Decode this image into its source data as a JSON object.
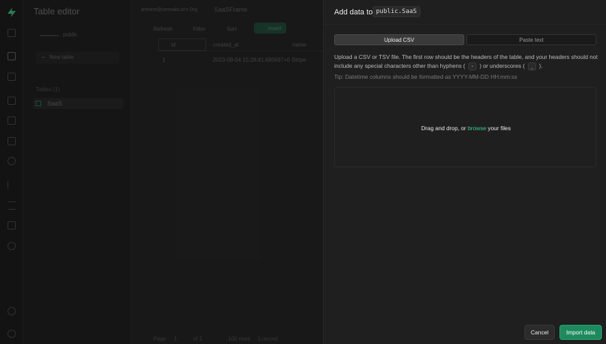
{
  "rail": {
    "icons": [
      "home-icon",
      "table-editor-icon",
      "sql-editor-icon",
      "database-icon",
      "auth-icon",
      "storage-icon",
      "edge-functions-icon",
      "realtime-icon",
      "reports-icon",
      "logs-icon",
      "api-docs-icon",
      "integrations-icon",
      "settings-icon",
      "user-icon"
    ]
  },
  "sidebar": {
    "title": "Table editor",
    "schema_value": "public",
    "new_table_label": "New table",
    "tables_heading": "Tables (1)",
    "tables": [
      {
        "label": "SaaS"
      }
    ]
  },
  "main": {
    "org": "antoine@ummaks.io's Org",
    "project": "SaaSFrame",
    "toolbar": {
      "refresh": "Refresh",
      "filter": "Filter",
      "sort": "Sort",
      "insert": "Insert"
    },
    "columns": [
      "id",
      "created_at",
      "name"
    ],
    "rows": [
      [
        "1",
        "2023-08-04 15:28:41.680697+0",
        "Stripe"
      ]
    ],
    "footer": {
      "page_label": "Page",
      "page_value": "1",
      "of": "of 1",
      "rows": "100 rows",
      "records": "1 record"
    }
  },
  "panel": {
    "title": "Add data to",
    "table_ref": "public.SaaS",
    "tabs": {
      "upload": "Upload CSV",
      "paste": "Paste text"
    },
    "desc_part1": "Upload a CSV or TSV file. The first row should be the headers of the table, and your headers should not include any special characters other than hyphens (",
    "hyphen": "-",
    "desc_part2": ") or underscores (",
    "underscore": "_",
    "desc_part3": ").",
    "tip": "Tip: Datetime columns should be formatted as YYYY-MM-DD HH:mm:ss",
    "drop_prefix": "Drag and drop, or",
    "drop_link": "browse",
    "drop_suffix": "your files",
    "cancel": "Cancel",
    "import": "Import data"
  },
  "colors": {
    "accent": "#3ecf8e",
    "primary_button": "#1d8a5e",
    "background": "#1c1c1c",
    "panel": "#1f1f1f"
  }
}
